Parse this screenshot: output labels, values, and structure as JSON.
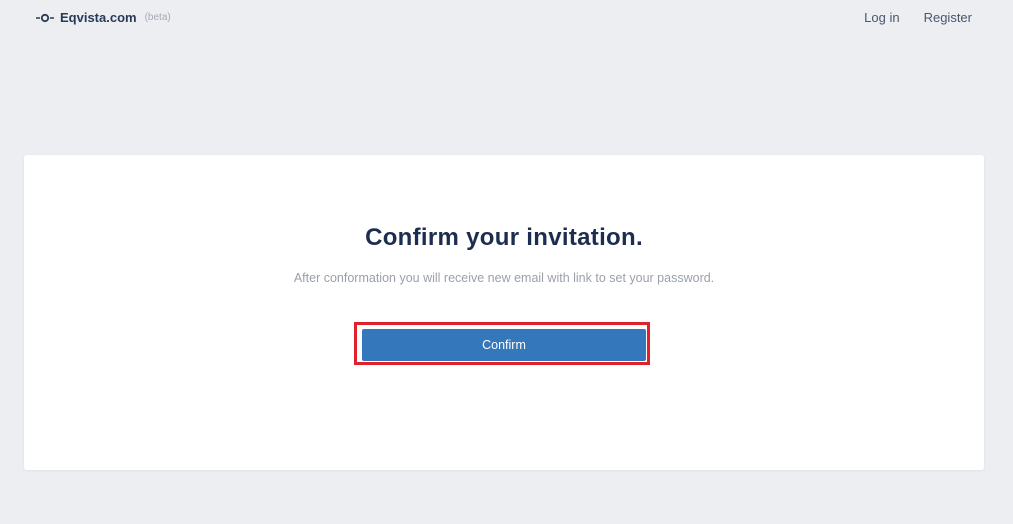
{
  "header": {
    "brand_name": "Eqvista.com",
    "brand_tag": "(beta)",
    "logo_icon": "link-node-icon",
    "nav": {
      "login_label": "Log in",
      "register_label": "Register"
    }
  },
  "card": {
    "title": "Confirm your invitation.",
    "subtitle": "After conformation you will receive new email with link to set your password.",
    "confirm_label": "Confirm"
  },
  "colors": {
    "background": "#eceef2",
    "primary_button": "#3477ba",
    "highlight_border": "#e0202a",
    "title_text": "#1c2d4f"
  }
}
